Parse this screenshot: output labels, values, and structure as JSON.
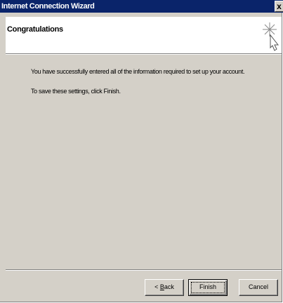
{
  "window": {
    "title": "Internet Connection Wizard",
    "close_label": "x"
  },
  "header": {
    "title": "Congratulations",
    "icon": "wizard-wand-icon"
  },
  "body": {
    "line1": "You have successfully entered all of the information required to set up your account.",
    "line2": "To save these settings, click Finish."
  },
  "buttons": {
    "back_arrow": "<",
    "back_accel": "B",
    "back_rest": "ack",
    "finish_label": "Finish",
    "cancel_label": "Cancel"
  },
  "colors": {
    "titlebar": "#0a246a",
    "dialog_bg": "#d4d0c8",
    "header_bg": "#ffffff"
  }
}
